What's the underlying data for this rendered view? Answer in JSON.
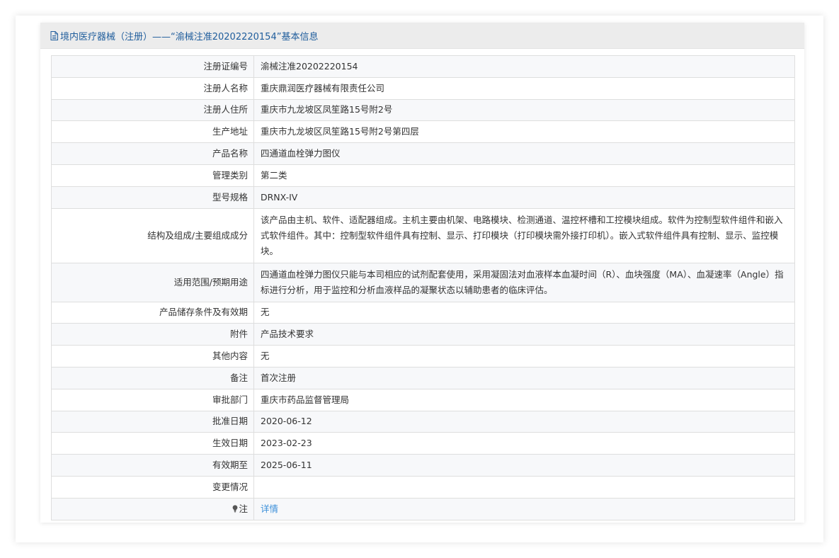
{
  "header": {
    "title": "境内医疗器械（注册）——“渝械注准20202220154”基本信息"
  },
  "rows": [
    {
      "label": "注册证编号",
      "value": "渝械注准20202220154"
    },
    {
      "label": "注册人名称",
      "value": "重庆鼎润医疗器械有限责任公司"
    },
    {
      "label": "注册人住所",
      "value": "重庆市九龙坡区凤笙路15号附2号"
    },
    {
      "label": "生产地址",
      "value": "重庆市九龙坡区凤笙路15号附2号第四层"
    },
    {
      "label": "产品名称",
      "value": "四通道血栓弹力图仪"
    },
    {
      "label": "管理类别",
      "value": "第二类"
    },
    {
      "label": "型号规格",
      "value": "DRNX-IV"
    },
    {
      "label": "结构及组成/主要组成成分",
      "value": "该产品由主机、软件、适配器组成。主机主要由机架、电路模块、检测通道、温控杯槽和工控模块组成。软件为控制型软件组件和嵌入式软件组件。其中：控制型软件组件具有控制、显示、打印模块（打印模块需外接打印机）。嵌入式软件组件具有控制、显示、监控模块。"
    },
    {
      "label": "适用范围/预期用途",
      "value": "四通道血栓弹力图仪只能与本司相应的试剂配套使用，采用凝固法对血液样本血凝时间（R）、血块强度（MA）、血凝速率（Angle）指标进行分析，用于监控和分析血液样品的凝聚状态以辅助患者的临床评估。"
    },
    {
      "label": "产品储存条件及有效期",
      "value": "无"
    },
    {
      "label": "附件",
      "value": "产品技术要求"
    },
    {
      "label": "其他内容",
      "value": "无"
    },
    {
      "label": "备注",
      "value": "首次注册"
    },
    {
      "label": "审批部门",
      "value": "重庆市药品监督管理局"
    },
    {
      "label": "批准日期",
      "value": "2020-06-12"
    },
    {
      "label": "生效日期",
      "value": "2023-02-23"
    },
    {
      "label": "有效期至",
      "value": "2025-06-11"
    },
    {
      "label": "变更情况",
      "value": ""
    }
  ],
  "note": {
    "label": "注",
    "link_text": "详情"
  },
  "colors": {
    "header_text": "#1f5d9c",
    "link": "#3b8fd9",
    "row_alt": "#f7f8fa"
  }
}
